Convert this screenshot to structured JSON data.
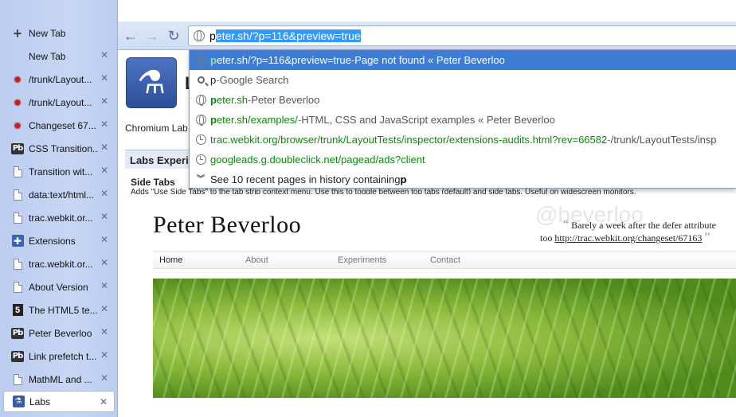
{
  "sidebar": {
    "new_tab_button": "New Tab",
    "tabs": [
      {
        "label": "New Tab",
        "icon": "none"
      },
      {
        "label": "/trunk/Layout...",
        "icon": "bug-icon"
      },
      {
        "label": "/trunk/Layout...",
        "icon": "bug-icon"
      },
      {
        "label": "Changeset 67...",
        "icon": "bug-icon"
      },
      {
        "label": "CSS Transition...",
        "icon": "pb-icon"
      },
      {
        "label": "Transition wit...",
        "icon": "page-icon"
      },
      {
        "label": "data:text/html...",
        "icon": "page-icon"
      },
      {
        "label": "trac.webkit.or...",
        "icon": "page-icon"
      },
      {
        "label": "Extensions",
        "icon": "extensions-icon"
      },
      {
        "label": "trac.webkit.or...",
        "icon": "page-icon"
      },
      {
        "label": "About Version",
        "icon": "page-icon"
      },
      {
        "label": "The HTML5 te...",
        "icon": "html5-icon"
      },
      {
        "label": "Peter Beverloo",
        "icon": "pb-icon"
      },
      {
        "label": "Link prefetch t...",
        "icon": "pb-icon"
      },
      {
        "label": "MathML and ...",
        "icon": "page-icon"
      },
      {
        "label": "Labs",
        "icon": "labs-icon",
        "active": true
      }
    ],
    "close_glyph": "✕"
  },
  "toolbar": {
    "back": "←",
    "forward": "→",
    "reload": "↻"
  },
  "omnibox": {
    "typed": "p",
    "autocomplete": "eter.sh/?p=116&preview=true"
  },
  "suggestions": [
    {
      "icon": "globe-icon",
      "url": "peter.sh/?p=116&preview=true",
      "sep": " - ",
      "desc": "Page not found « Peter Beverloo",
      "selected": true
    },
    {
      "icon": "search-icon",
      "url": "p",
      "sep": " - ",
      "desc": "Google Search"
    },
    {
      "icon": "globe-icon",
      "url": "peter.sh",
      "sep": " - ",
      "desc": "Peter Beverloo"
    },
    {
      "icon": "globe-icon",
      "url": "peter.sh/examples/",
      "sep": " - ",
      "desc": "HTML, CSS and JavaScript examples « Peter Beverloo"
    },
    {
      "icon": "clock-icon",
      "url": "trac.webkit.org/browser/trunk/LayoutTests/inspector/extensions-audits.html?rev=66582",
      "sep": " - ",
      "desc": "/trunk/LayoutTests/insp"
    },
    {
      "icon": "clock-icon",
      "url": "googleads.g.doubleclick.net/pagead/ads?client",
      "sep": "",
      "desc": ""
    },
    {
      "icon": "history-chevron-icon",
      "text_pre": "See 10 recent pages in history containing ",
      "text_bold": "p"
    }
  ],
  "labs_page": {
    "heading_initial": "L",
    "intro": "Chromium Lab",
    "section_title": "Labs Experi",
    "side_tabs_title": "Side Tabs",
    "side_tabs_desc": "Adds \"Use Side Tabs\" to the tab strip context menu. Use this to toggle between top tabs (default) and side tabs. Useful on widescreen monitors."
  },
  "website": {
    "title": "Peter Beverloo",
    "watermark": "@beverloo",
    "quote_open": "“",
    "quote_line1": "Barely a week after the defer attribute",
    "quote_line2_pre": "too ",
    "quote_link": "http://trac.webkit.org/changeset/67163",
    "quote_close": "”",
    "nav": [
      "Home",
      "About",
      "Experiments",
      "Contact"
    ]
  },
  "colors": {
    "sidebar_bg": "#c8d6f4",
    "selection": "#3e7dd6",
    "url_green": "#0a8a0a"
  }
}
